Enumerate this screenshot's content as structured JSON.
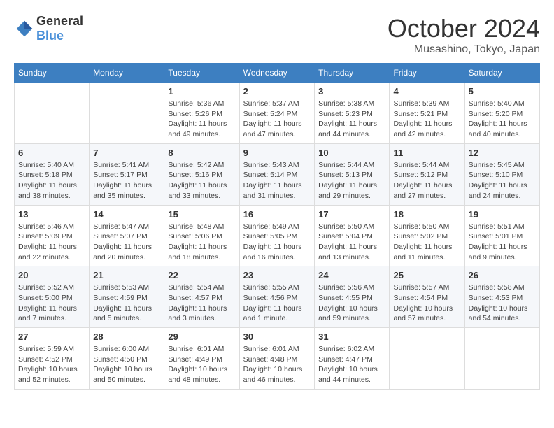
{
  "header": {
    "logo_general": "General",
    "logo_blue": "Blue",
    "month": "October 2024",
    "location": "Musashino, Tokyo, Japan"
  },
  "weekdays": [
    "Sunday",
    "Monday",
    "Tuesday",
    "Wednesday",
    "Thursday",
    "Friday",
    "Saturday"
  ],
  "weeks": [
    [
      {
        "day": "",
        "info": ""
      },
      {
        "day": "",
        "info": ""
      },
      {
        "day": "1",
        "info": "Sunrise: 5:36 AM\nSunset: 5:26 PM\nDaylight: 11 hours and 49 minutes."
      },
      {
        "day": "2",
        "info": "Sunrise: 5:37 AM\nSunset: 5:24 PM\nDaylight: 11 hours and 47 minutes."
      },
      {
        "day": "3",
        "info": "Sunrise: 5:38 AM\nSunset: 5:23 PM\nDaylight: 11 hours and 44 minutes."
      },
      {
        "day": "4",
        "info": "Sunrise: 5:39 AM\nSunset: 5:21 PM\nDaylight: 11 hours and 42 minutes."
      },
      {
        "day": "5",
        "info": "Sunrise: 5:40 AM\nSunset: 5:20 PM\nDaylight: 11 hours and 40 minutes."
      }
    ],
    [
      {
        "day": "6",
        "info": "Sunrise: 5:40 AM\nSunset: 5:18 PM\nDaylight: 11 hours and 38 minutes."
      },
      {
        "day": "7",
        "info": "Sunrise: 5:41 AM\nSunset: 5:17 PM\nDaylight: 11 hours and 35 minutes."
      },
      {
        "day": "8",
        "info": "Sunrise: 5:42 AM\nSunset: 5:16 PM\nDaylight: 11 hours and 33 minutes."
      },
      {
        "day": "9",
        "info": "Sunrise: 5:43 AM\nSunset: 5:14 PM\nDaylight: 11 hours and 31 minutes."
      },
      {
        "day": "10",
        "info": "Sunrise: 5:44 AM\nSunset: 5:13 PM\nDaylight: 11 hours and 29 minutes."
      },
      {
        "day": "11",
        "info": "Sunrise: 5:44 AM\nSunset: 5:12 PM\nDaylight: 11 hours and 27 minutes."
      },
      {
        "day": "12",
        "info": "Sunrise: 5:45 AM\nSunset: 5:10 PM\nDaylight: 11 hours and 24 minutes."
      }
    ],
    [
      {
        "day": "13",
        "info": "Sunrise: 5:46 AM\nSunset: 5:09 PM\nDaylight: 11 hours and 22 minutes."
      },
      {
        "day": "14",
        "info": "Sunrise: 5:47 AM\nSunset: 5:07 PM\nDaylight: 11 hours and 20 minutes."
      },
      {
        "day": "15",
        "info": "Sunrise: 5:48 AM\nSunset: 5:06 PM\nDaylight: 11 hours and 18 minutes."
      },
      {
        "day": "16",
        "info": "Sunrise: 5:49 AM\nSunset: 5:05 PM\nDaylight: 11 hours and 16 minutes."
      },
      {
        "day": "17",
        "info": "Sunrise: 5:50 AM\nSunset: 5:04 PM\nDaylight: 11 hours and 13 minutes."
      },
      {
        "day": "18",
        "info": "Sunrise: 5:50 AM\nSunset: 5:02 PM\nDaylight: 11 hours and 11 minutes."
      },
      {
        "day": "19",
        "info": "Sunrise: 5:51 AM\nSunset: 5:01 PM\nDaylight: 11 hours and 9 minutes."
      }
    ],
    [
      {
        "day": "20",
        "info": "Sunrise: 5:52 AM\nSunset: 5:00 PM\nDaylight: 11 hours and 7 minutes."
      },
      {
        "day": "21",
        "info": "Sunrise: 5:53 AM\nSunset: 4:59 PM\nDaylight: 11 hours and 5 minutes."
      },
      {
        "day": "22",
        "info": "Sunrise: 5:54 AM\nSunset: 4:57 PM\nDaylight: 11 hours and 3 minutes."
      },
      {
        "day": "23",
        "info": "Sunrise: 5:55 AM\nSunset: 4:56 PM\nDaylight: 11 hours and 1 minute."
      },
      {
        "day": "24",
        "info": "Sunrise: 5:56 AM\nSunset: 4:55 PM\nDaylight: 10 hours and 59 minutes."
      },
      {
        "day": "25",
        "info": "Sunrise: 5:57 AM\nSunset: 4:54 PM\nDaylight: 10 hours and 57 minutes."
      },
      {
        "day": "26",
        "info": "Sunrise: 5:58 AM\nSunset: 4:53 PM\nDaylight: 10 hours and 54 minutes."
      }
    ],
    [
      {
        "day": "27",
        "info": "Sunrise: 5:59 AM\nSunset: 4:52 PM\nDaylight: 10 hours and 52 minutes."
      },
      {
        "day": "28",
        "info": "Sunrise: 6:00 AM\nSunset: 4:50 PM\nDaylight: 10 hours and 50 minutes."
      },
      {
        "day": "29",
        "info": "Sunrise: 6:01 AM\nSunset: 4:49 PM\nDaylight: 10 hours and 48 minutes."
      },
      {
        "day": "30",
        "info": "Sunrise: 6:01 AM\nSunset: 4:48 PM\nDaylight: 10 hours and 46 minutes."
      },
      {
        "day": "31",
        "info": "Sunrise: 6:02 AM\nSunset: 4:47 PM\nDaylight: 10 hours and 44 minutes."
      },
      {
        "day": "",
        "info": ""
      },
      {
        "day": "",
        "info": ""
      }
    ]
  ]
}
